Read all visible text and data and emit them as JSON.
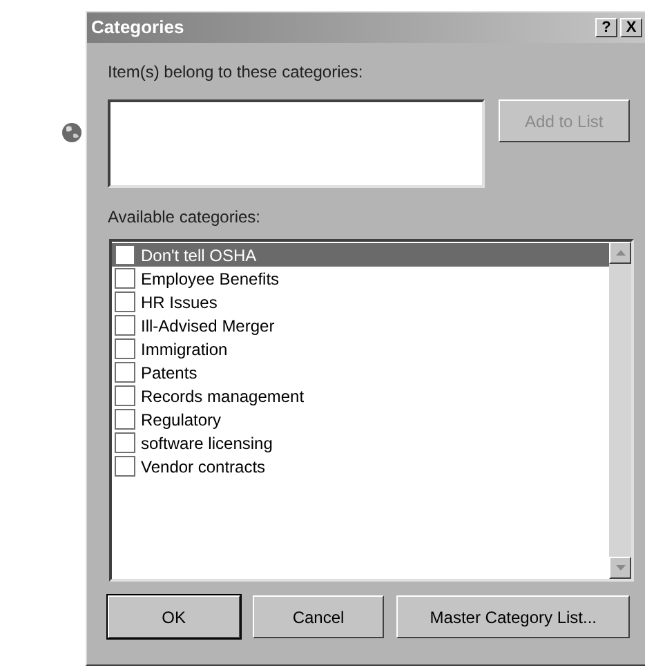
{
  "window": {
    "title": "Categories",
    "help_button": "?",
    "close_button": "X"
  },
  "assigned": {
    "label": "Item(s) belong to these categories:"
  },
  "add_button": {
    "label": "Add to List",
    "disabled": true
  },
  "available": {
    "label": "Available categories:",
    "items": [
      {
        "label": "Don't tell OSHA",
        "checked": false,
        "selected": true
      },
      {
        "label": "Employee Benefits",
        "checked": false,
        "selected": false
      },
      {
        "label": "HR Issues",
        "checked": false,
        "selected": false
      },
      {
        "label": "Ill-Advised Merger",
        "checked": false,
        "selected": false
      },
      {
        "label": "Immigration",
        "checked": false,
        "selected": false
      },
      {
        "label": "Patents",
        "checked": false,
        "selected": false
      },
      {
        "label": "Records management",
        "checked": false,
        "selected": false
      },
      {
        "label": "Regulatory",
        "checked": false,
        "selected": false
      },
      {
        "label": "software licensing",
        "checked": false,
        "selected": false
      },
      {
        "label": "Vendor contracts",
        "checked": false,
        "selected": false
      }
    ]
  },
  "buttons": [
    {
      "label": "OK",
      "default": true
    },
    {
      "label": "Cancel",
      "default": false
    },
    {
      "label": "Master Category List...",
      "default": false
    }
  ]
}
